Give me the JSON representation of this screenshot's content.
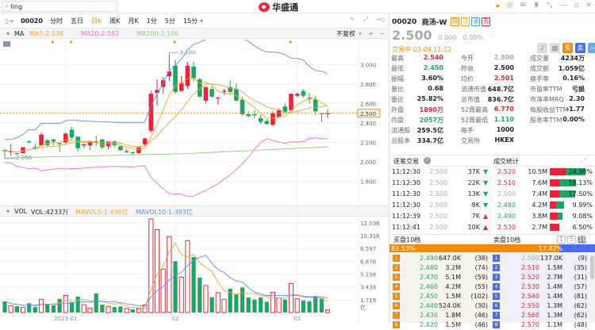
{
  "search": {
    "value": "ling"
  },
  "logo": "华盛通",
  "toolbar": {
    "code": "00020",
    "tabs": [
      "分时",
      "五日",
      "日K",
      "周K",
      "月K",
      "1分",
      "5分",
      "15分"
    ],
    "active": "日K"
  },
  "ma": {
    "label": "MA",
    "ma5": "MA5:2.576",
    "ma20": "MA20:2.582",
    "ma100": "MA100:2.106",
    "adjust": "不复权"
  },
  "vol": {
    "label": "VOL",
    "vol": "VOL:4233万",
    "mavol5": "MAVOL5:1.436亿",
    "mavol10": "MAVOL10:1.893亿"
  },
  "colors": {
    "up": "#e8243b",
    "down": "#1fa463",
    "ma5": "#f5a623",
    "ma20": "#f06bd0",
    "ma100": "#8ed07a",
    "upper": "#5b8df5",
    "accent": "#f58a07",
    "blue": "#4a6cf0"
  },
  "chart_data": {
    "type": "candlestick",
    "price_ticks": [
      "3.000",
      "2.800",
      "2.600",
      "2.400",
      "2.200",
      "2.000",
      "1.800"
    ],
    "price_range": [
      1.6,
      3.25
    ],
    "current_price": "2.500",
    "high_label": "3.100",
    "low_label": "2.050",
    "vol_ticks": [
      "12.036",
      "10.316",
      "8.597",
      "6.878",
      "5.158",
      "3.439",
      "1.719"
    ],
    "vol_unit": "亿",
    "x_labels": [
      {
        "i": 10,
        "text": "2023-01"
      },
      {
        "i": 28,
        "text": "02"
      },
      {
        "i": 48,
        "text": "03"
      }
    ],
    "candles": [
      [
        2.12,
        2.11,
        2.13,
        2.05
      ],
      [
        2.1,
        2.11,
        2.18,
        2.06
      ],
      [
        2.09,
        2.08,
        2.09,
        2.07
      ],
      [
        2.09,
        2.15,
        2.15,
        2.09
      ],
      [
        2.21,
        2.2,
        2.22,
        2.19
      ],
      [
        2.15,
        2.14,
        2.19,
        2.13
      ],
      [
        2.17,
        2.28,
        2.3,
        2.17
      ],
      [
        2.22,
        2.17,
        2.24,
        2.15
      ],
      [
        2.23,
        2.21,
        2.24,
        2.17
      ],
      [
        2.19,
        2.18,
        2.2,
        2.1
      ],
      [
        2.2,
        2.29,
        2.3,
        2.19
      ],
      [
        2.33,
        2.25,
        2.36,
        2.23
      ],
      [
        2.26,
        2.14,
        2.26,
        2.11
      ],
      [
        2.17,
        2.18,
        2.19,
        2.14
      ],
      [
        2.17,
        2.2,
        2.22,
        2.12
      ],
      [
        2.21,
        2.2,
        2.27,
        2.16
      ],
      [
        2.23,
        2.15,
        2.24,
        2.13
      ],
      [
        2.16,
        2.21,
        2.21,
        2.13
      ],
      [
        2.21,
        2.17,
        2.22,
        2.15
      ],
      [
        2.16,
        2.12,
        2.17,
        2.11
      ],
      [
        2.1,
        2.11,
        2.13,
        2.09
      ],
      [
        2.1,
        2.09,
        2.1,
        2.07
      ],
      [
        2.09,
        2.15,
        2.15,
        2.08
      ],
      [
        2.18,
        2.24,
        2.25,
        2.17
      ],
      [
        2.32,
        2.7,
        2.73,
        2.3
      ],
      [
        2.71,
        2.74,
        2.85,
        2.58
      ],
      [
        2.77,
        2.84,
        2.87,
        2.7
      ],
      [
        2.88,
        2.93,
        3.1,
        2.83
      ],
      [
        2.99,
        2.72,
        3.05,
        2.7
      ],
      [
        2.73,
        2.81,
        2.88,
        2.72
      ],
      [
        2.78,
        2.99,
        3.03,
        2.75
      ],
      [
        2.98,
        2.86,
        3.03,
        2.83
      ],
      [
        2.85,
        2.67,
        2.86,
        2.66
      ],
      [
        2.63,
        2.77,
        2.77,
        2.6
      ],
      [
        2.75,
        2.67,
        2.78,
        2.66
      ],
      [
        2.65,
        2.66,
        2.67,
        2.59
      ],
      [
        2.72,
        2.73,
        2.75,
        2.69
      ],
      [
        2.77,
        2.72,
        2.84,
        2.69
      ],
      [
        2.75,
        2.63,
        2.81,
        2.62
      ],
      [
        2.64,
        2.49,
        2.67,
        2.47
      ],
      [
        2.49,
        2.47,
        2.52,
        2.46
      ],
      [
        2.49,
        2.48,
        2.53,
        2.45
      ],
      [
        2.45,
        2.41,
        2.48,
        2.39
      ],
      [
        2.42,
        2.39,
        2.44,
        2.38
      ],
      [
        2.38,
        2.5,
        2.52,
        2.37
      ],
      [
        2.46,
        2.53,
        2.55,
        2.45
      ],
      [
        2.57,
        2.51,
        2.6,
        2.5
      ],
      [
        2.53,
        2.7,
        2.7,
        2.52
      ],
      [
        2.68,
        2.7,
        2.71,
        2.67
      ],
      [
        2.73,
        2.68,
        2.75,
        2.66
      ],
      [
        2.66,
        2.65,
        2.71,
        2.6
      ],
      [
        2.64,
        2.52,
        2.68,
        2.48
      ],
      [
        2.5,
        2.49,
        2.5,
        2.41
      ],
      [
        2.49,
        2.5,
        2.54,
        2.45
      ]
    ],
    "volumes": [
      1.49,
      0.92,
      0.85,
      0.71,
      1.24,
      0.74,
      1.77,
      1.06,
      0.96,
      1.84,
      2.3,
      1.38,
      2.13,
      1.06,
      0.6,
      2.55,
      1.06,
      0.82,
      0.74,
      0.82,
      0.53,
      0.43,
      0.53,
      1.03,
      12.55,
      11.13,
      5.82,
      10.18,
      6.88,
      4.75,
      9.65,
      7.45,
      4.68,
      3.62,
      2.06,
      2.66,
      1.77,
      3.19,
      2.45,
      3.37,
      2.02,
      1.74,
      2.02,
      1.45,
      2.73,
      1.95,
      1.74,
      3.9,
      1.84,
      1.63,
      1.52,
      2.2,
      1.91,
      0.35
    ]
  },
  "quote": {
    "code": "00020",
    "name": "商汤-W",
    "badges": [
      "融",
      "沽",
      "通",
      "荒"
    ],
    "price": "2.500",
    "change": "0.000",
    "pct": "0.00%",
    "status": "交易中 03-09 11:12"
  },
  "stats": [
    [
      [
        "最高",
        "2.540",
        "red"
      ],
      [
        "今开",
        "2.500",
        "grey"
      ],
      [
        "成交量",
        "4234万",
        ""
      ]
    ],
    [
      [
        "最低",
        "2.450",
        "green"
      ],
      [
        "昨收",
        "2.500",
        ""
      ],
      [
        "成交额",
        "1.059亿",
        ""
      ]
    ],
    [
      [
        "振幅",
        "3.60%",
        ""
      ],
      [
        "均价",
        "2.501",
        "red"
      ],
      [
        "换手率",
        "0.16%",
        ""
      ]
    ],
    [
      [
        "量比",
        "0.68",
        ""
      ],
      [
        "流通市值",
        "648.7亿",
        ""
      ],
      [
        "市盈率TTM",
        "亏损",
        ""
      ]
    ],
    [
      [
        "委比",
        "25.82%",
        ""
      ],
      [
        "总市值",
        "836.7亿",
        ""
      ],
      [
        "市净率MRQ",
        "2.30",
        ""
      ]
    ],
    [
      [
        "外盘",
        "1890万",
        "red"
      ],
      [
        "52周最高",
        "6.770",
        "red"
      ],
      [
        "每股收益TTM",
        "-1.77",
        ""
      ]
    ],
    [
      [
        "内盘",
        "2057万",
        "green"
      ],
      [
        "52周最低",
        "1.110",
        "green"
      ],
      [
        "股息率TTM",
        "0.00%",
        ""
      ]
    ],
    [
      [
        "流通股",
        "259.5亿",
        ""
      ],
      [
        "每手",
        "1000",
        ""
      ]
    ],
    [
      [
        "总股本",
        "334.7亿",
        ""
      ],
      [
        "交易所",
        "HKEX",
        ""
      ]
    ]
  ],
  "trades": {
    "title": "逐笔交易",
    "stats_title": "成交统计",
    "rows": [
      [
        "11:12:30",
        "2.500",
        "37K",
        "down"
      ],
      [
        "11:12:30",
        "2.500",
        "22K",
        "down"
      ],
      [
        "11:12:30",
        "2.500",
        "13K",
        "down"
      ],
      [
        "11:12:30",
        "2.500",
        "8K",
        "down"
      ],
      [
        "11:12:39",
        "2.500",
        "7K",
        "up"
      ],
      [
        "11:12:41",
        "2.500",
        "10K",
        "up"
      ]
    ],
    "dist": [
      [
        "2.520",
        "10.5M",
        "24.98%",
        24.98,
        0.46,
        "red"
      ],
      [
        "2.510",
        "7.6M",
        "18.13%",
        18.13,
        0.38,
        "red"
      ],
      [
        "2.500",
        "7.4M",
        "17.50%",
        17.5,
        0.38,
        "grey"
      ],
      [
        "2.480",
        "4.2M",
        "9.99%",
        9.99,
        0.45,
        "green"
      ],
      [
        "2.490",
        "3.8M",
        "9.08%",
        9.08,
        0.61,
        "green"
      ],
      [
        "2.530",
        "2.7M",
        "6.50%",
        6.5,
        1.0,
        "red"
      ]
    ]
  },
  "book": {
    "bid_title": "买盘10档",
    "ask_title": "卖盘10档",
    "levels": [
      "1",
      "5",
      "10"
    ],
    "bid_pct": "82.53%",
    "ask_pct": "17.47%",
    "bid_ratio": 82.53,
    "bids": [
      [
        "1",
        "2.490",
        "647.0K",
        "(38)"
      ],
      [
        "2",
        "2.480",
        "3.2M",
        "(74)"
      ],
      [
        "3",
        "2.470",
        "5.1M",
        "(59)"
      ],
      [
        "4",
        "2.460",
        "4.2M",
        "(55)"
      ],
      [
        "5",
        "2.450",
        "1.5M",
        "(102)"
      ],
      [
        "6",
        "2.440",
        "524.0K",
        "(30)"
      ],
      [
        "7",
        "2.430",
        "1.8M",
        "(46)"
      ],
      [
        "8",
        "2.420",
        "1.5M",
        "(46)"
      ]
    ],
    "asks": [
      [
        "1",
        "2.500",
        "137.0K",
        "(9)"
      ],
      [
        "2",
        "2.510",
        "1.5M",
        "(35)"
      ],
      [
        "3",
        "2.520",
        "2.7M",
        "(31)"
      ],
      [
        "4",
        "2.530",
        "1.4M",
        "(57)"
      ],
      [
        "5",
        "2.540",
        "1.4M",
        "(81)"
      ],
      [
        "6",
        "2.550",
        "1.3M",
        "(62)"
      ],
      [
        "7",
        "2.560",
        "1.3M",
        "(62)"
      ],
      [
        "8",
        "2.570",
        "1.1M",
        "(48)"
      ]
    ]
  }
}
